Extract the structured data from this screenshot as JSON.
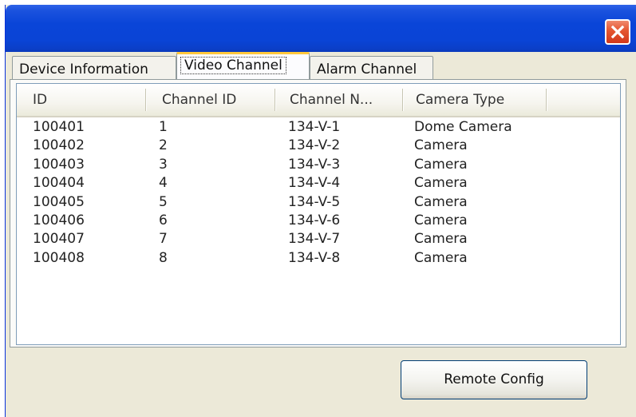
{
  "window": {
    "title": ""
  },
  "tabs": [
    {
      "label": "Device Information",
      "active": false
    },
    {
      "label": "Video Channel",
      "active": true
    },
    {
      "label": "Alarm Channel",
      "active": false
    }
  ],
  "table": {
    "columns": [
      "ID",
      "Channel ID",
      "Channel N...",
      "Camera Type"
    ],
    "rows": [
      [
        "100401",
        "1",
        "134-V-1",
        "Dome Camera"
      ],
      [
        "100402",
        "2",
        "134-V-2",
        "Camera"
      ],
      [
        "100403",
        "3",
        "134-V-3",
        "Camera"
      ],
      [
        "100404",
        "4",
        "134-V-4",
        "Camera"
      ],
      [
        "100405",
        "5",
        "134-V-5",
        "Camera"
      ],
      [
        "100406",
        "6",
        "134-V-6",
        "Camera"
      ],
      [
        "100407",
        "7",
        "134-V-7",
        "Camera"
      ],
      [
        "100408",
        "8",
        "134-V-8",
        "Camera"
      ]
    ]
  },
  "buttons": {
    "remote_config": "Remote Config"
  },
  "icons": {
    "close": "close-icon"
  },
  "colors": {
    "titlebar": "#0A45D8",
    "close_button": "#E4552F",
    "window_face": "#ECE9D8",
    "active_tab_highlight": "#FFC83C"
  }
}
